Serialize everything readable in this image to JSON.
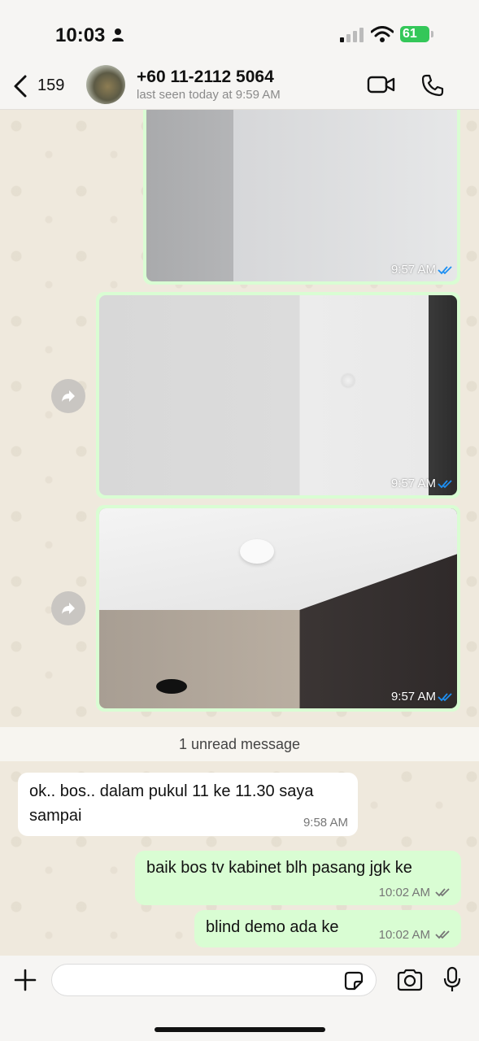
{
  "status_bar": {
    "time": "10:03",
    "battery": "61"
  },
  "header": {
    "back_count": "159",
    "contact_name": "+60 11-2112 5064",
    "last_seen": "last seen today at 9:59 AM"
  },
  "images": [
    {
      "time": "9:57 AM"
    },
    {
      "time": "9:57 AM"
    },
    {
      "time": "9:57 AM"
    }
  ],
  "unread_label": "1 unread message",
  "messages": [
    {
      "direction": "in",
      "text": "ok.. bos.. dalam pukul 11 ke 11.30 saya sampai",
      "time": "9:58 AM"
    },
    {
      "direction": "out",
      "text": "baik bos tv kabinet blh pasang jgk ke",
      "time": "10:02 AM"
    },
    {
      "direction": "out",
      "text": "blind demo ada ke",
      "time": "10:02 AM"
    }
  ],
  "input": {
    "placeholder": ""
  },
  "colors": {
    "outgoing_bubble": "#d9fdd3",
    "incoming_bubble": "#ffffff",
    "read_tick": "#1d8ff2",
    "battery": "#34c759"
  }
}
